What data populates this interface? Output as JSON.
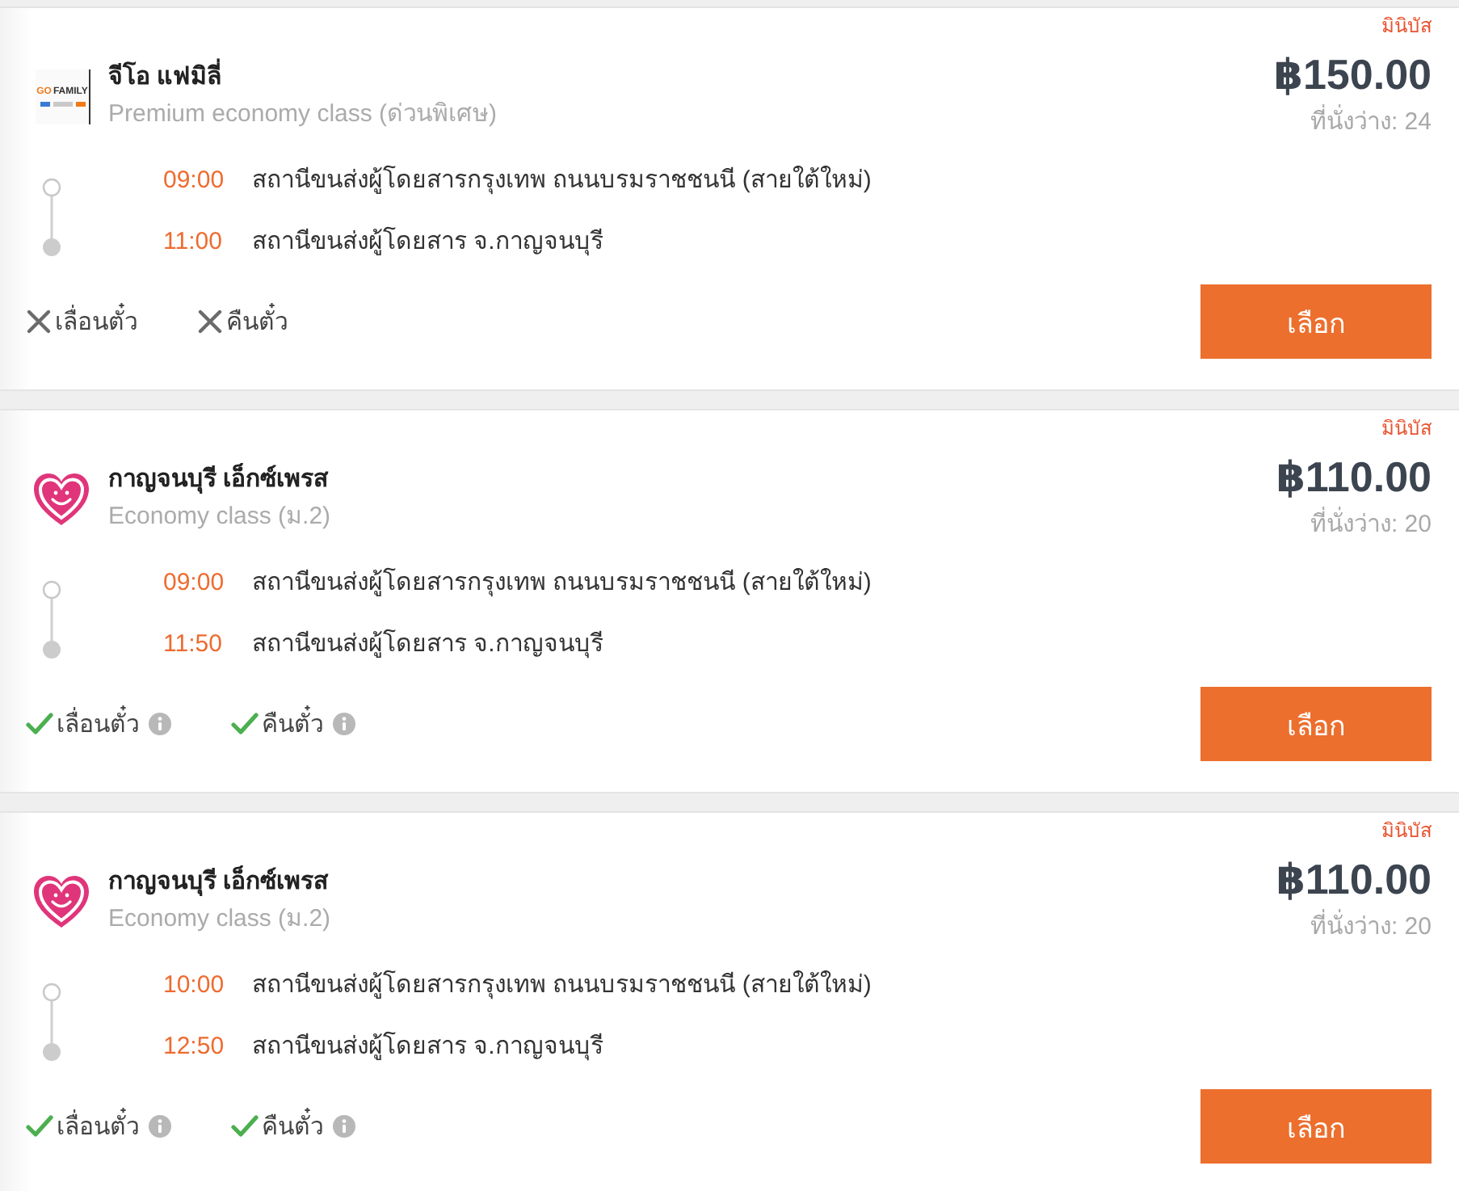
{
  "trips": [
    {
      "vehicle_type": "มินิบัส",
      "operator": {
        "name": "จีโอ แฟมิลี่",
        "logo": {
          "kind": "wordmark",
          "words": [
            "GO",
            "FAMILY"
          ]
        }
      },
      "service_class": "Premium economy class (ด่วนพิเศษ)",
      "price": "฿150.00",
      "seats": "ที่นั่งว่าง: 24",
      "stops": [
        {
          "kind": "origin",
          "time": "09:00",
          "station": "สถานีขนส่งผู้โดยสารกรุงเทพ ถนนบรมราชชนนี (สายใต้ใหม่)"
        },
        {
          "kind": "destination",
          "time": "11:00",
          "station": "สถานีขนส่งผู้โดยสาร จ.กาญจนบุรี"
        }
      ],
      "policies": [
        {
          "label": "เลื่อนตั๋ว",
          "allowed": false
        },
        {
          "label": "คืนตั๋ว",
          "allowed": false
        }
      ],
      "button": "เลือก"
    },
    {
      "vehicle_type": "มินิบัส",
      "operator": {
        "name": "กาญจนบุรี เอ็กซ์เพรส",
        "logo": {
          "kind": "heart"
        }
      },
      "service_class": "Economy class (ม.2)",
      "price": "฿110.00",
      "seats": "ที่นั่งว่าง: 20",
      "stops": [
        {
          "kind": "origin",
          "time": "09:00",
          "station": "สถานีขนส่งผู้โดยสารกรุงเทพ ถนนบรมราชชนนี (สายใต้ใหม่)"
        },
        {
          "kind": "destination",
          "time": "11:50",
          "station": "สถานีขนส่งผู้โดยสาร จ.กาญจนบุรี"
        }
      ],
      "policies": [
        {
          "label": "เลื่อนตั๋ว",
          "allowed": true
        },
        {
          "label": "คืนตั๋ว",
          "allowed": true
        }
      ],
      "button": "เลือก"
    },
    {
      "vehicle_type": "มินิบัส",
      "operator": {
        "name": "กาญจนบุรี เอ็กซ์เพรส",
        "logo": {
          "kind": "heart"
        }
      },
      "service_class": "Economy class (ม.2)",
      "price": "฿110.00",
      "seats": "ที่นั่งว่าง: 20",
      "stops": [
        {
          "kind": "origin",
          "time": "10:00",
          "station": "สถานีขนส่งผู้โดยสารกรุงเทพ ถนนบรมราชชนนี (สายใต้ใหม่)"
        },
        {
          "kind": "destination",
          "time": "12:50",
          "station": "สถานีขนส่งผู้โดยสาร จ.กาญจนบุรี"
        }
      ],
      "policies": [
        {
          "label": "เลื่อนตั๋ว",
          "allowed": true
        },
        {
          "label": "คืนตั๋ว",
          "allowed": true
        }
      ],
      "button": "เลือก"
    }
  ]
}
